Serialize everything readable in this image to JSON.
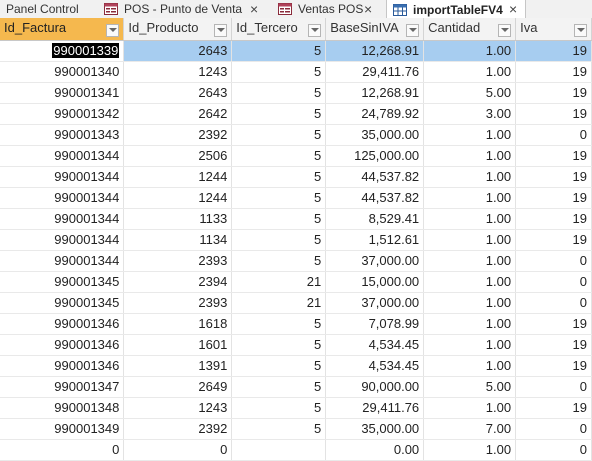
{
  "tabs": [
    {
      "label": "Panel Control",
      "icon": "form-icon"
    },
    {
      "label": "POS - Punto de Venta",
      "icon": "form-icon",
      "close": "×"
    },
    {
      "label": "Ventas POS",
      "icon": "form-icon",
      "close": "×"
    },
    {
      "label": "importTableFV4",
      "icon": "table-icon",
      "close": "×",
      "active": true
    }
  ],
  "columns": [
    "Id_Factura",
    "Id_Producto",
    "Id_Tercero",
    "BaseSinIVA",
    "Cantidad",
    "Iva"
  ],
  "rows": [
    {
      "id_factura": "990001339",
      "id_producto": "2643",
      "id_tercero": "5",
      "base": "12,268.91",
      "cantidad": "1.00",
      "iva": "19"
    },
    {
      "id_factura": "990001340",
      "id_producto": "1243",
      "id_tercero": "5",
      "base": "29,411.76",
      "cantidad": "1.00",
      "iva": "19"
    },
    {
      "id_factura": "990001341",
      "id_producto": "2643",
      "id_tercero": "5",
      "base": "12,268.91",
      "cantidad": "5.00",
      "iva": "19"
    },
    {
      "id_factura": "990001342",
      "id_producto": "2642",
      "id_tercero": "5",
      "base": "24,789.92",
      "cantidad": "3.00",
      "iva": "19"
    },
    {
      "id_factura": "990001343",
      "id_producto": "2392",
      "id_tercero": "5",
      "base": "35,000.00",
      "cantidad": "1.00",
      "iva": "0"
    },
    {
      "id_factura": "990001344",
      "id_producto": "2506",
      "id_tercero": "5",
      "base": "125,000.00",
      "cantidad": "1.00",
      "iva": "19"
    },
    {
      "id_factura": "990001344",
      "id_producto": "1244",
      "id_tercero": "5",
      "base": "44,537.82",
      "cantidad": "1.00",
      "iva": "19"
    },
    {
      "id_factura": "990001344",
      "id_producto": "1244",
      "id_tercero": "5",
      "base": "44,537.82",
      "cantidad": "1.00",
      "iva": "19"
    },
    {
      "id_factura": "990001344",
      "id_producto": "1133",
      "id_tercero": "5",
      "base": "8,529.41",
      "cantidad": "1.00",
      "iva": "19"
    },
    {
      "id_factura": "990001344",
      "id_producto": "1134",
      "id_tercero": "5",
      "base": "1,512.61",
      "cantidad": "1.00",
      "iva": "19"
    },
    {
      "id_factura": "990001344",
      "id_producto": "2393",
      "id_tercero": "5",
      "base": "37,000.00",
      "cantidad": "1.00",
      "iva": "0"
    },
    {
      "id_factura": "990001345",
      "id_producto": "2394",
      "id_tercero": "21",
      "base": "15,000.00",
      "cantidad": "1.00",
      "iva": "0"
    },
    {
      "id_factura": "990001345",
      "id_producto": "2393",
      "id_tercero": "21",
      "base": "37,000.00",
      "cantidad": "1.00",
      "iva": "0"
    },
    {
      "id_factura": "990001346",
      "id_producto": "1618",
      "id_tercero": "5",
      "base": "7,078.99",
      "cantidad": "1.00",
      "iva": "19"
    },
    {
      "id_factura": "990001346",
      "id_producto": "1601",
      "id_tercero": "5",
      "base": "4,534.45",
      "cantidad": "1.00",
      "iva": "19"
    },
    {
      "id_factura": "990001346",
      "id_producto": "1391",
      "id_tercero": "5",
      "base": "4,534.45",
      "cantidad": "1.00",
      "iva": "19"
    },
    {
      "id_factura": "990001347",
      "id_producto": "2649",
      "id_tercero": "5",
      "base": "90,000.00",
      "cantidad": "5.00",
      "iva": "0"
    },
    {
      "id_factura": "990001348",
      "id_producto": "1243",
      "id_tercero": "5",
      "base": "29,411.76",
      "cantidad": "1.00",
      "iva": "19"
    },
    {
      "id_factura": "990001349",
      "id_producto": "2392",
      "id_tercero": "5",
      "base": "35,000.00",
      "cantidad": "7.00",
      "iva": "0"
    },
    {
      "id_factura": "0",
      "id_producto": "0",
      "id_tercero": "",
      "base": "0.00",
      "cantidad": "1.00",
      "iva": "0"
    }
  ],
  "colors": {
    "header_active": "#f5b84e",
    "row_selected": "#a7cdf0"
  }
}
